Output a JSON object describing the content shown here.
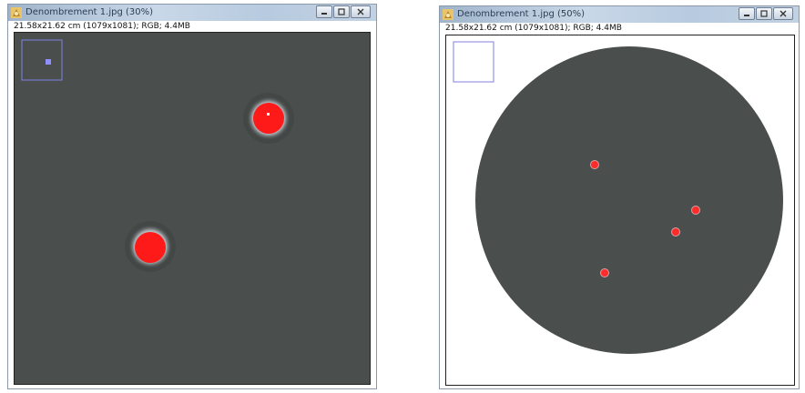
{
  "windows": [
    {
      "title": "Denombrement 1.jpg (30%)",
      "info": "21.58x21.62 cm (1079x1081); RGB; 4.4MB"
    },
    {
      "title": "Denombrement 1.jpg (50%)",
      "info": "21.58x21.62 cm (1079x1081); RGB; 4.4MB"
    }
  ],
  "colors": {
    "dish": "#4a4f4e",
    "colony": "#ff1a1a",
    "colony_halo": "#b9bcbe",
    "navigator": "#7f80e0",
    "title_text": "#2c3e55"
  },
  "icons": {
    "app": "imagej-microscope-icon",
    "minimize": "minimize-icon",
    "maximize": "maximize-icon",
    "close": "close-icon"
  }
}
